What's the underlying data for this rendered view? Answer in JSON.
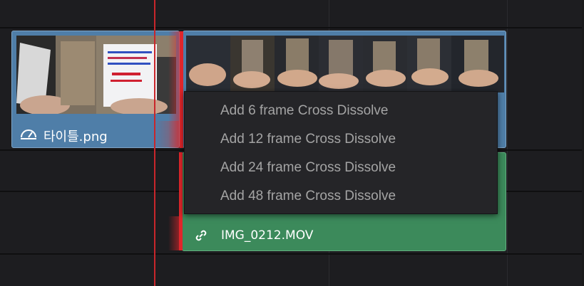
{
  "timeline": {
    "video_clip_title": "타이틀.png",
    "audio_clip_title": "IMG_0212.MOV"
  },
  "context_menu": {
    "items": [
      "Add 6 frame Cross Dissolve",
      "Add 12 frame Cross Dissolve",
      "Add 24 frame Cross Dissolve",
      "Add 48 frame Cross Dissolve"
    ]
  },
  "colors": {
    "playhead": "#c8262b",
    "video_clip": "#4f7ea8",
    "audio_clip": "#3c8a5b",
    "menu_bg": "#252528",
    "menu_text": "#a4a4a4"
  },
  "icons": {
    "video_clip_icon": "speedometer-icon",
    "audio_clip_icon": "link-icon"
  }
}
